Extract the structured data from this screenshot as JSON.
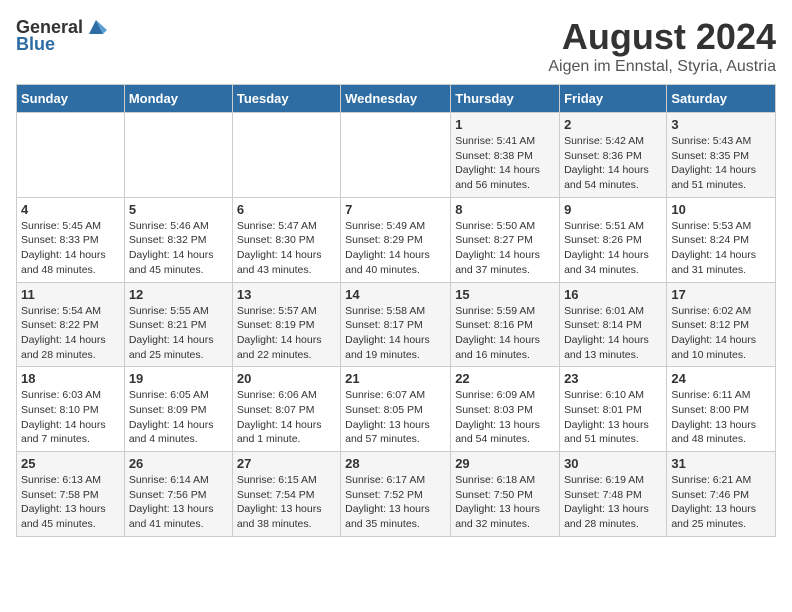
{
  "header": {
    "logo_general": "General",
    "logo_blue": "Blue",
    "main_title": "August 2024",
    "subtitle": "Aigen im Ennstal, Styria, Austria"
  },
  "days_of_week": [
    "Sunday",
    "Monday",
    "Tuesday",
    "Wednesday",
    "Thursday",
    "Friday",
    "Saturday"
  ],
  "weeks": [
    [
      {
        "day": "",
        "info": ""
      },
      {
        "day": "",
        "info": ""
      },
      {
        "day": "",
        "info": ""
      },
      {
        "day": "",
        "info": ""
      },
      {
        "day": "1",
        "info": "Sunrise: 5:41 AM\nSunset: 8:38 PM\nDaylight: 14 hours\nand 56 minutes."
      },
      {
        "day": "2",
        "info": "Sunrise: 5:42 AM\nSunset: 8:36 PM\nDaylight: 14 hours\nand 54 minutes."
      },
      {
        "day": "3",
        "info": "Sunrise: 5:43 AM\nSunset: 8:35 PM\nDaylight: 14 hours\nand 51 minutes."
      }
    ],
    [
      {
        "day": "4",
        "info": "Sunrise: 5:45 AM\nSunset: 8:33 PM\nDaylight: 14 hours\nand 48 minutes."
      },
      {
        "day": "5",
        "info": "Sunrise: 5:46 AM\nSunset: 8:32 PM\nDaylight: 14 hours\nand 45 minutes."
      },
      {
        "day": "6",
        "info": "Sunrise: 5:47 AM\nSunset: 8:30 PM\nDaylight: 14 hours\nand 43 minutes."
      },
      {
        "day": "7",
        "info": "Sunrise: 5:49 AM\nSunset: 8:29 PM\nDaylight: 14 hours\nand 40 minutes."
      },
      {
        "day": "8",
        "info": "Sunrise: 5:50 AM\nSunset: 8:27 PM\nDaylight: 14 hours\nand 37 minutes."
      },
      {
        "day": "9",
        "info": "Sunrise: 5:51 AM\nSunset: 8:26 PM\nDaylight: 14 hours\nand 34 minutes."
      },
      {
        "day": "10",
        "info": "Sunrise: 5:53 AM\nSunset: 8:24 PM\nDaylight: 14 hours\nand 31 minutes."
      }
    ],
    [
      {
        "day": "11",
        "info": "Sunrise: 5:54 AM\nSunset: 8:22 PM\nDaylight: 14 hours\nand 28 minutes."
      },
      {
        "day": "12",
        "info": "Sunrise: 5:55 AM\nSunset: 8:21 PM\nDaylight: 14 hours\nand 25 minutes."
      },
      {
        "day": "13",
        "info": "Sunrise: 5:57 AM\nSunset: 8:19 PM\nDaylight: 14 hours\nand 22 minutes."
      },
      {
        "day": "14",
        "info": "Sunrise: 5:58 AM\nSunset: 8:17 PM\nDaylight: 14 hours\nand 19 minutes."
      },
      {
        "day": "15",
        "info": "Sunrise: 5:59 AM\nSunset: 8:16 PM\nDaylight: 14 hours\nand 16 minutes."
      },
      {
        "day": "16",
        "info": "Sunrise: 6:01 AM\nSunset: 8:14 PM\nDaylight: 14 hours\nand 13 minutes."
      },
      {
        "day": "17",
        "info": "Sunrise: 6:02 AM\nSunset: 8:12 PM\nDaylight: 14 hours\nand 10 minutes."
      }
    ],
    [
      {
        "day": "18",
        "info": "Sunrise: 6:03 AM\nSunset: 8:10 PM\nDaylight: 14 hours\nand 7 minutes."
      },
      {
        "day": "19",
        "info": "Sunrise: 6:05 AM\nSunset: 8:09 PM\nDaylight: 14 hours\nand 4 minutes."
      },
      {
        "day": "20",
        "info": "Sunrise: 6:06 AM\nSunset: 8:07 PM\nDaylight: 14 hours\nand 1 minute."
      },
      {
        "day": "21",
        "info": "Sunrise: 6:07 AM\nSunset: 8:05 PM\nDaylight: 13 hours\nand 57 minutes."
      },
      {
        "day": "22",
        "info": "Sunrise: 6:09 AM\nSunset: 8:03 PM\nDaylight: 13 hours\nand 54 minutes."
      },
      {
        "day": "23",
        "info": "Sunrise: 6:10 AM\nSunset: 8:01 PM\nDaylight: 13 hours\nand 51 minutes."
      },
      {
        "day": "24",
        "info": "Sunrise: 6:11 AM\nSunset: 8:00 PM\nDaylight: 13 hours\nand 48 minutes."
      }
    ],
    [
      {
        "day": "25",
        "info": "Sunrise: 6:13 AM\nSunset: 7:58 PM\nDaylight: 13 hours\nand 45 minutes."
      },
      {
        "day": "26",
        "info": "Sunrise: 6:14 AM\nSunset: 7:56 PM\nDaylight: 13 hours\nand 41 minutes."
      },
      {
        "day": "27",
        "info": "Sunrise: 6:15 AM\nSunset: 7:54 PM\nDaylight: 13 hours\nand 38 minutes."
      },
      {
        "day": "28",
        "info": "Sunrise: 6:17 AM\nSunset: 7:52 PM\nDaylight: 13 hours\nand 35 minutes."
      },
      {
        "day": "29",
        "info": "Sunrise: 6:18 AM\nSunset: 7:50 PM\nDaylight: 13 hours\nand 32 minutes."
      },
      {
        "day": "30",
        "info": "Sunrise: 6:19 AM\nSunset: 7:48 PM\nDaylight: 13 hours\nand 28 minutes."
      },
      {
        "day": "31",
        "info": "Sunrise: 6:21 AM\nSunset: 7:46 PM\nDaylight: 13 hours\nand 25 minutes."
      }
    ]
  ]
}
